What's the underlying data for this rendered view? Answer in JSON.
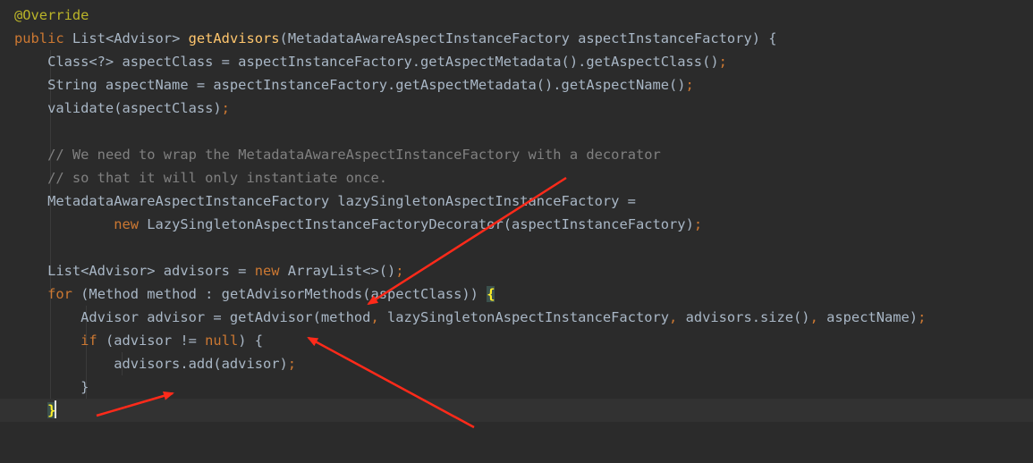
{
  "theme": {
    "background": "#2b2b2b",
    "current_line": "#323232",
    "default_text": "#a9b7c6",
    "keyword": "#cc7832",
    "annotation": "#bbb529",
    "method_decl": "#ffc66d",
    "comment": "#808080",
    "brace_highlight": "#ffef28",
    "annotation_arrows": "#ff2a1a"
  },
  "code_lines": [
    [
      {
        "t": "@Override",
        "k": "ann"
      }
    ],
    [
      {
        "t": "public",
        "k": "kw"
      },
      {
        "t": " List<Advisor> "
      },
      {
        "t": "getAdvisors",
        "k": "fn"
      },
      {
        "t": "(MetadataAwareAspectInstanceFactory aspectInstanceFactory) {"
      }
    ],
    [
      {
        "t": "    Class<?> aspectClass = aspectInstanceFactory.getAspectMetadata().getAspectClass()"
      },
      {
        "t": ";",
        "k": "kw"
      }
    ],
    [
      {
        "t": "    String aspectName = aspectInstanceFactory.getAspectMetadata().getAspectName()"
      },
      {
        "t": ";",
        "k": "kw"
      }
    ],
    [
      {
        "t": "    validate(aspectClass)"
      },
      {
        "t": ";",
        "k": "kw"
      }
    ],
    [
      {
        "t": ""
      }
    ],
    [
      {
        "t": "    "
      },
      {
        "t": "// We need to wrap the MetadataAwareAspectInstanceFactory with a decorator",
        "k": "cm"
      }
    ],
    [
      {
        "t": "    "
      },
      {
        "t": "// so that it will only instantiate once.",
        "k": "cm"
      }
    ],
    [
      {
        "t": "    MetadataAwareAspectInstanceFactory lazySingletonAspectInstanceFactory ="
      }
    ],
    [
      {
        "t": "            "
      },
      {
        "t": "new",
        "k": "kw"
      },
      {
        "t": " LazySingletonAspectInstanceFactoryDecorator(aspectInstanceFactory)"
      },
      {
        "t": ";",
        "k": "kw"
      }
    ],
    [
      {
        "t": ""
      }
    ],
    [
      {
        "t": "    List<Advisor> advisors = "
      },
      {
        "t": "new",
        "k": "kw"
      },
      {
        "t": " ArrayList<>()"
      },
      {
        "t": ";",
        "k": "kw"
      }
    ],
    [
      {
        "t": "    "
      },
      {
        "t": "for",
        "k": "kw"
      },
      {
        "t": " (Method method : getAdvisorMethods(aspectClass)) "
      },
      {
        "t": "{",
        "k": "br"
      }
    ],
    [
      {
        "t": "        Advisor advisor = getAdvisor(method"
      },
      {
        "t": ",",
        "k": "kw"
      },
      {
        "t": " lazySingletonAspectInstanceFactory"
      },
      {
        "t": ",",
        "k": "kw"
      },
      {
        "t": " advisors.size()"
      },
      {
        "t": ",",
        "k": "kw"
      },
      {
        "t": " aspectName)"
      },
      {
        "t": ";",
        "k": "kw"
      }
    ],
    [
      {
        "t": "        "
      },
      {
        "t": "if",
        "k": "kw"
      },
      {
        "t": " (advisor != "
      },
      {
        "t": "null",
        "k": "kw"
      },
      {
        "t": ") {"
      }
    ],
    [
      {
        "t": "            advisors.add(advisor)"
      },
      {
        "t": ";",
        "k": "kw"
      }
    ],
    [
      {
        "t": "        }"
      }
    ],
    [
      {
        "t": "    "
      },
      {
        "t": "}",
        "k": "brc"
      }
    ]
  ],
  "caret_line_index": 17
}
